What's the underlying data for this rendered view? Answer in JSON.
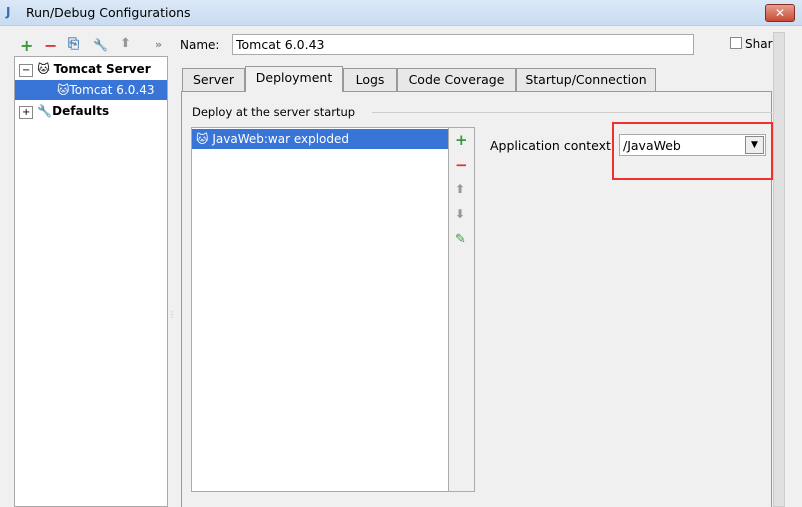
{
  "window": {
    "title": "Run/Debug Configurations",
    "close": "✕"
  },
  "toolbar": {
    "add": "+",
    "remove": "−",
    "copy": "⎘",
    "edit": "🔧",
    "up": "⬆",
    "more": "»"
  },
  "tree": {
    "items": [
      {
        "label": "Tomcat Server",
        "expander": "−"
      },
      {
        "label": "Tomcat 6.0.43"
      },
      {
        "label": "Defaults",
        "expander": "+"
      }
    ]
  },
  "name": {
    "label": "Name:",
    "value": "Tomcat 6.0.43"
  },
  "share": {
    "label": "Shar"
  },
  "tabs": [
    "Server",
    "Deployment",
    "Logs",
    "Code Coverage",
    "Startup/Connection"
  ],
  "deploy": {
    "heading": "Deploy at the server startup",
    "items": [
      "JavaWeb:war exploded"
    ],
    "add": "+",
    "remove": "−",
    "up": "⬆",
    "down": "⬇",
    "edit": "✎"
  },
  "context": {
    "label": "Application context:",
    "value": "/JavaWeb"
  }
}
